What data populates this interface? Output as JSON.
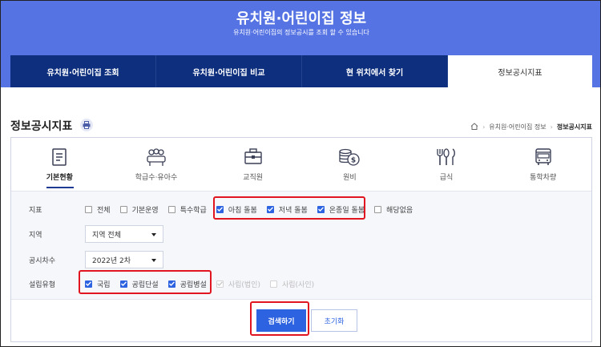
{
  "header": {
    "title": "유치원·어린이집 정보",
    "subtitle": "유치원·어린이집의 정보공시를 조회 할 수 있습니다"
  },
  "tabs": [
    {
      "label": "유치원·어린이집 조회"
    },
    {
      "label": "유치원·어린이집 비교"
    },
    {
      "label": "현 위치에서 찾기"
    },
    {
      "label": "정보공시지표"
    }
  ],
  "page": {
    "title": "정보공시지표"
  },
  "breadcrumb": {
    "items": [
      "유치원·어린이집 정보",
      "정보공시지표"
    ]
  },
  "categories": [
    {
      "label": "기본현황",
      "icon": "document-icon",
      "active": true
    },
    {
      "label": "학급수·유아수",
      "icon": "group-icon"
    },
    {
      "label": "교직원",
      "icon": "briefcase-icon"
    },
    {
      "label": "원비",
      "icon": "coins-icon"
    },
    {
      "label": "급식",
      "icon": "utensils-icon"
    },
    {
      "label": "통학차량",
      "icon": "bus-icon"
    }
  ],
  "filters": {
    "indicator": {
      "label": "지표",
      "options": [
        {
          "label": "전체",
          "checked": false
        },
        {
          "label": "기본운영",
          "checked": false
        },
        {
          "label": "특수학급",
          "checked": false
        },
        {
          "label": "아침 돌봄",
          "checked": true
        },
        {
          "label": "저녁 돌봄",
          "checked": true
        },
        {
          "label": "온종일 돌봄",
          "checked": true
        },
        {
          "label": "해당없음",
          "checked": false
        }
      ]
    },
    "region": {
      "label": "지역",
      "value": "지역 전체"
    },
    "period": {
      "label": "공시차수",
      "value": "2022년 2차"
    },
    "type": {
      "label": "설립유형",
      "options": [
        {
          "label": "국립",
          "checked": true,
          "disabled": false
        },
        {
          "label": "공립단설",
          "checked": true,
          "disabled": false
        },
        {
          "label": "공립병설",
          "checked": true,
          "disabled": false
        },
        {
          "label": "사립(법인)",
          "checked": true,
          "disabled": true
        },
        {
          "label": "사립(사인)",
          "checked": false,
          "disabled": true
        }
      ]
    }
  },
  "buttons": {
    "search": "검색하기",
    "reset": "초기화"
  },
  "colors": {
    "header": "#5573e3",
    "nav": "#0d2f7e",
    "accent": "#2d63e0",
    "highlight": "#e0151f"
  }
}
